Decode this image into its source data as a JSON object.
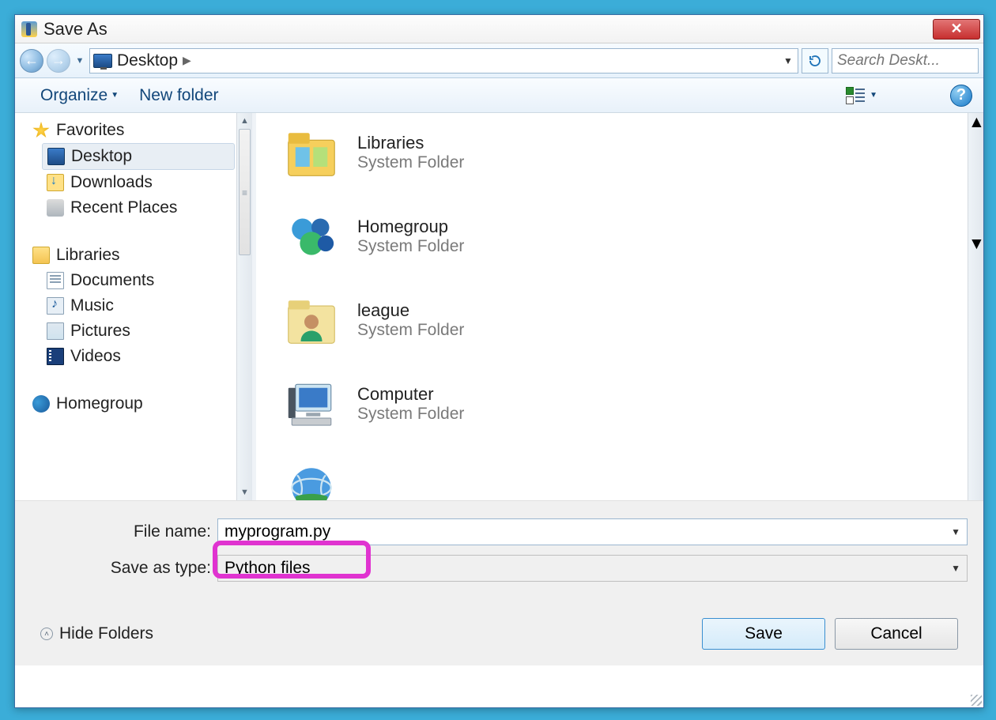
{
  "title": "Save As",
  "nav": {
    "location": "Desktop",
    "search_placeholder": "Search Deskt..."
  },
  "toolbar": {
    "organize": "Organize",
    "newfolder": "New folder"
  },
  "sidebar": {
    "favorites_label": "Favorites",
    "favorites": [
      {
        "key": "desktop",
        "label": "Desktop",
        "selected": true
      },
      {
        "key": "downloads",
        "label": "Downloads"
      },
      {
        "key": "recent",
        "label": "Recent Places"
      }
    ],
    "libraries_label": "Libraries",
    "libraries": [
      {
        "key": "documents",
        "label": "Documents"
      },
      {
        "key": "music",
        "label": "Music"
      },
      {
        "key": "pictures",
        "label": "Pictures"
      },
      {
        "key": "videos",
        "label": "Videos"
      }
    ],
    "homegroup_label": "Homegroup"
  },
  "main": {
    "items": [
      {
        "name": "Libraries",
        "sub": "System Folder",
        "icon": "libraries"
      },
      {
        "name": "Homegroup",
        "sub": "System Folder",
        "icon": "homegroup"
      },
      {
        "name": "league",
        "sub": "System Folder",
        "icon": "user"
      },
      {
        "name": "Computer",
        "sub": "System Folder",
        "icon": "computer"
      }
    ]
  },
  "fields": {
    "filename_label": "File name:",
    "filename_value": "myprogram.py",
    "savetype_label": "Save as type:",
    "savetype_value": "Python files"
  },
  "footer": {
    "hide_folders": "Hide Folders",
    "save": "Save",
    "cancel": "Cancel"
  }
}
